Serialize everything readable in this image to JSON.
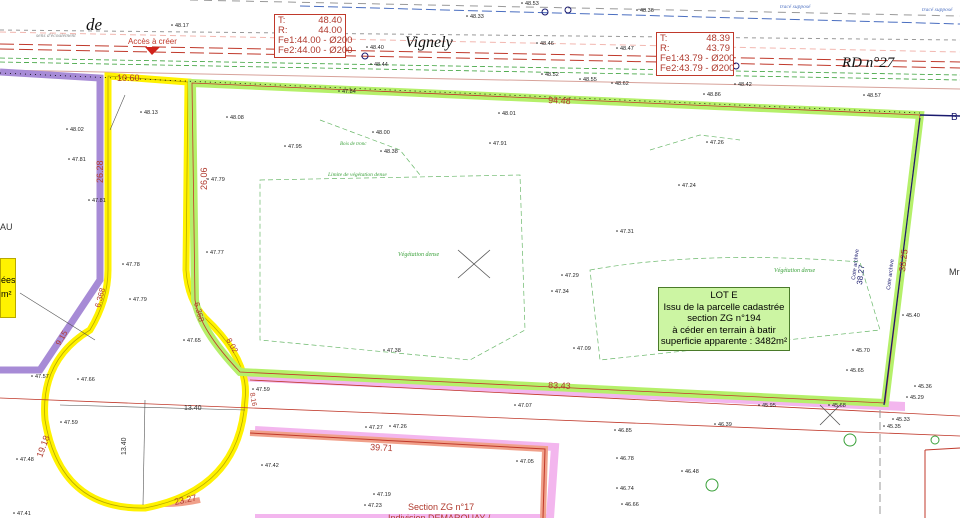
{
  "map": {
    "road_word_de": "de",
    "road_word_vignely": "Vignely",
    "road_name": "RD n°27",
    "access_label": "Accès à créer",
    "flow_label": "sens d'écoulement",
    "trace_label": "tracé supposé",
    "lot_info": {
      "line1": "LOT E",
      "line2": "Issu de la parcelle cadastrée",
      "line3": "section ZG n°194",
      "line4": "à céder en terrain à batir",
      "line5": "superficie apparente : 3482m²"
    },
    "section_title": "Section ZG n°17",
    "section_owner": "Indivision DEMAROUAY /",
    "left_partial_au": "AU",
    "left_partial_ees": "ées",
    "left_partial_m2": "m²",
    "right_partial_b": "B",
    "right_partial_m": "Mr",
    "vegetation_dense": "Végétation dense",
    "vegetation_limit": "Limite de végétation dense",
    "tree_base": "Bois de tronc",
    "colors": {
      "lot_green": "#b5f06a",
      "yellow_road": "#fff200",
      "purple": "#a78bd6",
      "pink": "#f3b6ee",
      "salmon": "#f0a08a",
      "boundary_red": "#c0392b",
      "dim_red": "#b03a2e",
      "green_survey": "#3aa13a",
      "navy": "#1a1a6e"
    },
    "manhole_left": {
      "t_label": "T:",
      "t_val": "48.40",
      "r_label": "R:",
      "r_val": "44.00",
      "fe1": "Fe1:44.00 - Ø200",
      "fe2": "Fe2:44.00 - Ø200"
    },
    "manhole_right": {
      "t_label": "T:",
      "t_val": "48.39",
      "r_label": "R:",
      "r_val": "43.79",
      "fe1": "Fe1:43.79 - Ø200",
      "fe2": "Fe2:43.79 - Ø200"
    },
    "dimensions": {
      "d_1060": "10.60",
      "d_9448": "94.48",
      "d_2628": "26.28",
      "d_2606": "26.06",
      "d_3825": "38.25",
      "d_6368a": "6.368",
      "d_6368b": "6.368",
      "d_915": "9.15",
      "d_802": "8.02",
      "d_8343": "83.43",
      "d_8.16": "8.16",
      "d_1340h": "13.40",
      "d_1340v": "13.40",
      "d_3971": "39.71",
      "d_2327": "23.27",
      "d_1918": "19.18",
      "d_3827": "38.27",
      "cote_archive": "Cote archive"
    },
    "points": [
      {
        "v": "48.17"
      },
      {
        "v": "48.33"
      },
      {
        "v": "48.46"
      },
      {
        "v": "48.47"
      },
      {
        "v": "48.40"
      },
      {
        "v": "48.44"
      },
      {
        "v": "48.52"
      },
      {
        "v": "48.55"
      },
      {
        "v": "48.62"
      },
      {
        "v": "48.86"
      },
      {
        "v": "48.42"
      },
      {
        "v": "48.57"
      },
      {
        "v": "48.13"
      },
      {
        "v": "48.08"
      },
      {
        "v": "48.02"
      },
      {
        "v": "48.00"
      },
      {
        "v": "48.01"
      },
      {
        "v": "47.95"
      },
      {
        "v": "47.91"
      },
      {
        "v": "47.81"
      },
      {
        "v": "47.81"
      },
      {
        "v": "47.79"
      },
      {
        "v": "47.26"
      },
      {
        "v": "47.24"
      },
      {
        "v": "47.78"
      },
      {
        "v": "47.77"
      },
      {
        "v": "47.31"
      },
      {
        "v": "47.29"
      },
      {
        "v": "47.34"
      },
      {
        "v": "47.79"
      },
      {
        "v": "47.65"
      },
      {
        "v": "47.38"
      },
      {
        "v": "47.09"
      },
      {
        "v": "45.70"
      },
      {
        "v": "45.65"
      },
      {
        "v": "45.40"
      },
      {
        "v": "47.66"
      },
      {
        "v": "47.59"
      },
      {
        "v": "47.07"
      },
      {
        "v": "45.95"
      },
      {
        "v": "46.39"
      },
      {
        "v": "45.36"
      },
      {
        "v": "45.29"
      },
      {
        "v": "45.33"
      },
      {
        "v": "45.35"
      },
      {
        "v": "47.59"
      },
      {
        "v": "47.27"
      },
      {
        "v": "47.26"
      },
      {
        "v": "46.85"
      },
      {
        "v": "47.48"
      },
      {
        "v": "47.42"
      },
      {
        "v": "47.05"
      },
      {
        "v": "46.78"
      },
      {
        "v": "46.48"
      },
      {
        "v": "47.19"
      },
      {
        "v": "47.23"
      },
      {
        "v": "46.74"
      },
      {
        "v": "46.66"
      },
      {
        "v": "47.41"
      },
      {
        "v": "48.38"
      },
      {
        "v": "47.84"
      },
      {
        "v": "48.53"
      },
      {
        "v": "48.36"
      },
      {
        "v": "45.68"
      },
      {
        "v": "47.57"
      }
    ]
  }
}
